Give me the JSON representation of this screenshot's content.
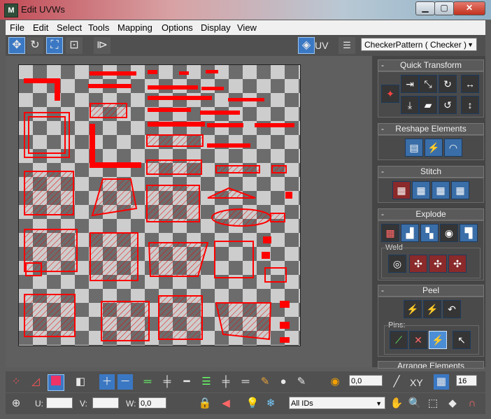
{
  "window": {
    "title": "Edit UVWs",
    "app_icon_text": "M"
  },
  "titlebar_buttons": {
    "minimize": "▁",
    "maximize": "▢",
    "close": "✕"
  },
  "menu": [
    "File",
    "Edit",
    "Select",
    "Tools",
    "Mapping",
    "Options",
    "Display",
    "View"
  ],
  "top_toolbar": {
    "uv_label": "UV",
    "texture_select": "CheckerPattern  ( Checker )"
  },
  "panel": {
    "quick_transform": "Quick Transform",
    "reshape": "Reshape Elements",
    "stitch": "Stitch",
    "explode": "Explode",
    "weld": "Weld",
    "peel": "Peel",
    "pins": "Pins:",
    "arrange": "Arrange Elements",
    "collapse_symbol": "-"
  },
  "bottom_toolbar": {
    "spinner_value": "0,0",
    "xy_label": "XY",
    "grid_count": "16"
  },
  "status_bar": {
    "u_label": "U:",
    "v_label": "V:",
    "w_label": "W:",
    "w_value": "0,0",
    "id_filter": "All IDs"
  },
  "colors": {
    "uv_wire": "#ff0000",
    "accent": "#3b78c4"
  }
}
